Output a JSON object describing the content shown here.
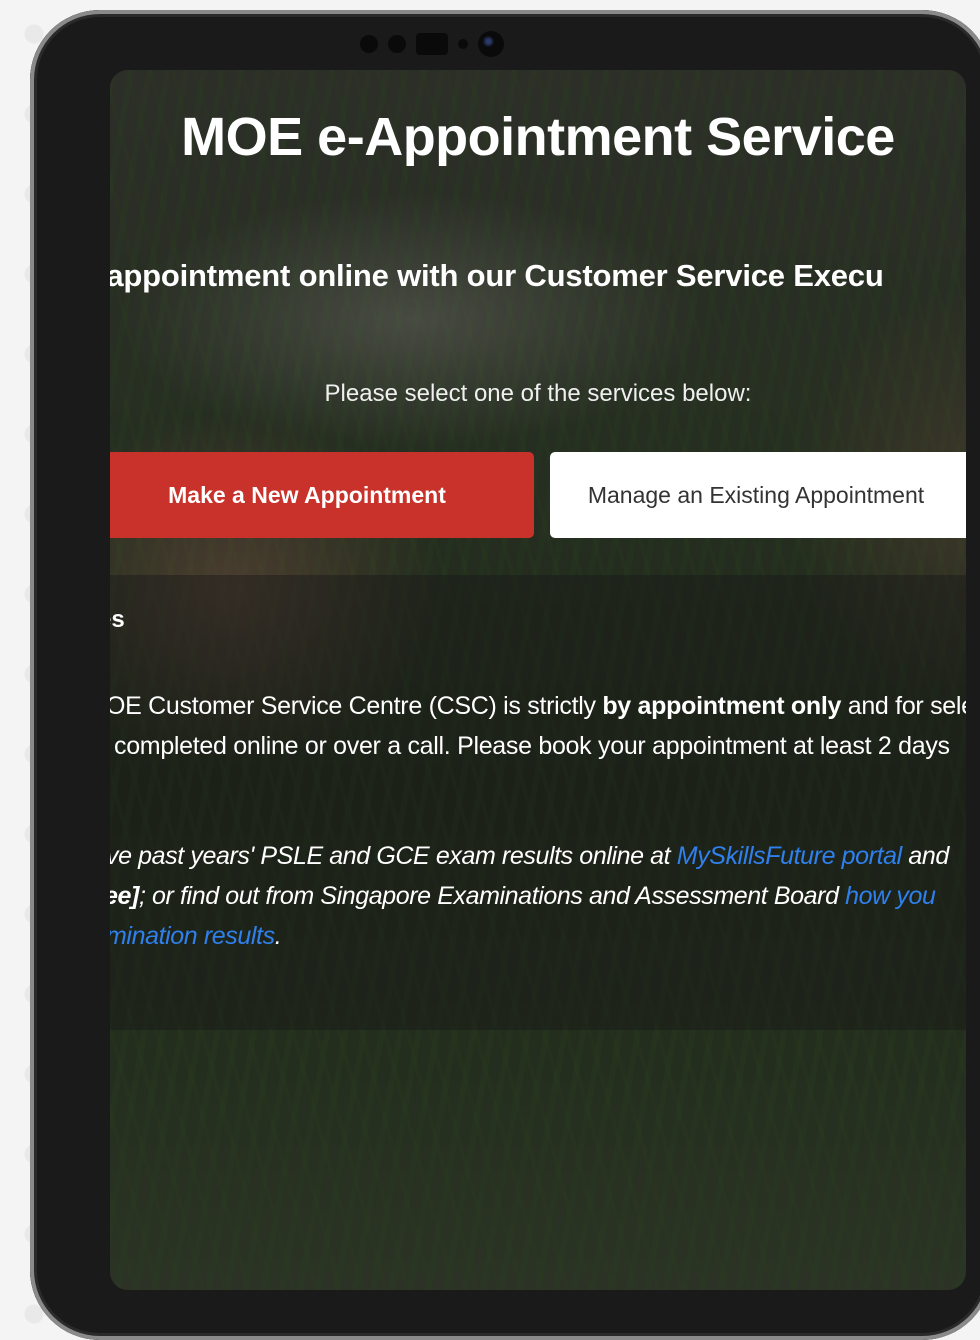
{
  "page": {
    "title": "MOE e-Appointment Service",
    "tagline": "ok an appointment online with our Customer Service Execu",
    "select_prompt": "Please select one of the services below:"
  },
  "actions": {
    "new_appointment_label": "Make a New Appointment",
    "manage_appointment_label": "Manage an Existing Appointment"
  },
  "notes": {
    "heading": "es",
    "csc_line1_pre": "OE Customer Service Centre (CSC) is strictly ",
    "csc_line1_bold": "by appointment only",
    "csc_line1_post": " and for sele",
    "csc_line2": "completed online or over a call. Please book your appointment at least 2 days",
    "results_line1_pre": "ve past years' PSLE and GCE exam results online at ",
    "results_line1_link": "MySkillsFuture portal",
    "results_line1_post": " and",
    "results_line2_bold": "ee]",
    "results_line2_text": "; or find out from Singapore Examinations and Assessment Board ",
    "results_line2_link": "how you",
    "results_line3_link": "mination results",
    "results_line3_post": "."
  },
  "colors": {
    "primary_button": "#c8322a",
    "secondary_button": "#ffffff",
    "link": "#2f80ed"
  },
  "icons": {
    "camera": "front-camera-icon"
  }
}
